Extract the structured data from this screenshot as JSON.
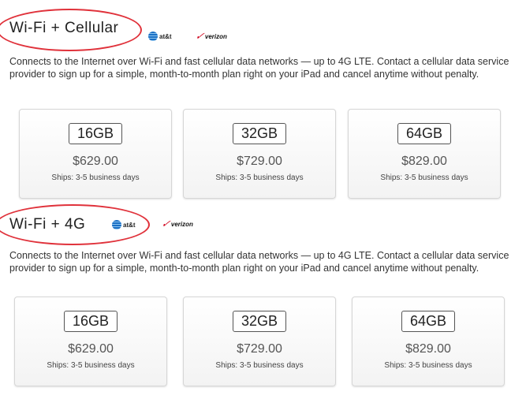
{
  "sections": [
    {
      "heading": "Wi-Fi + Cellular",
      "att_label": "at&t",
      "verizon_label": "verizon",
      "description": "Connects to the Internet over Wi-Fi and fast cellular data networks — up to 4G LTE. Contact a cellular data service provider to sign up for a simple, month-to-month plan right on your iPad and cancel anytime without penalty.",
      "options": [
        {
          "capacity": "16GB",
          "price": "$629.00",
          "ships": "Ships: 3-5 business days"
        },
        {
          "capacity": "32GB",
          "price": "$729.00",
          "ships": "Ships: 3-5 business days"
        },
        {
          "capacity": "64GB",
          "price": "$829.00",
          "ships": "Ships: 3-5 business days"
        }
      ]
    },
    {
      "heading": "Wi-Fi + 4G",
      "att_label": "at&t",
      "verizon_label": "verizon",
      "description": "Connects to the Internet over Wi-Fi and fast cellular data networks — up to 4G LTE. Contact a cellular data service provider to sign up for a simple, month-to-month plan right on your iPad and cancel anytime without penalty.",
      "options": [
        {
          "capacity": "16GB",
          "price": "$629.00",
          "ships": "Ships: 3-5 business days"
        },
        {
          "capacity": "32GB",
          "price": "$729.00",
          "ships": "Ships: 3-5 business days"
        },
        {
          "capacity": "64GB",
          "price": "$829.00",
          "ships": "Ships: 3-5 business days"
        }
      ]
    }
  ],
  "colors": {
    "annotation_circle": "#e0323b",
    "verizon_check": "#d0021b",
    "att_blue": "#1a6fc4"
  }
}
